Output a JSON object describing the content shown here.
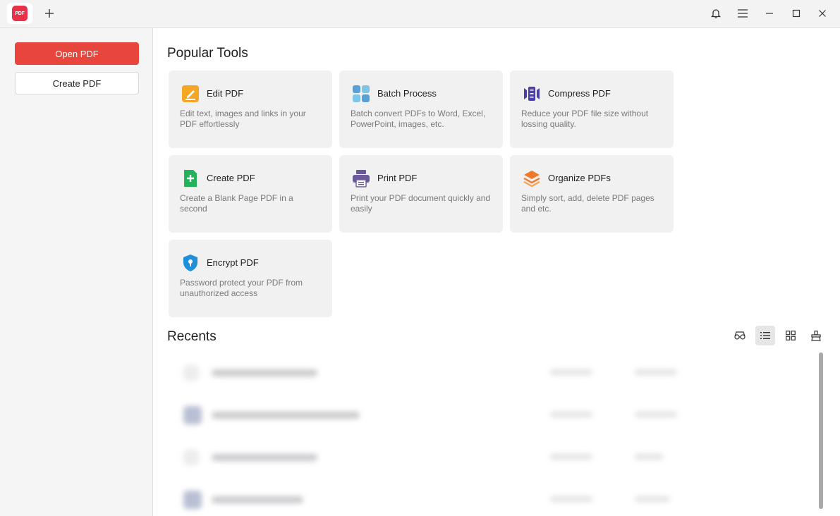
{
  "titlebar": {
    "app_logo_text": "PDF",
    "icons": [
      "plus-icon",
      "bell-icon",
      "menu-icon",
      "minimize-icon",
      "maximize-icon",
      "close-icon"
    ]
  },
  "sidebar": {
    "open_label": "Open PDF",
    "create_label": "Create PDF"
  },
  "main": {
    "popular_title": "Popular Tools",
    "recents_title": "Recents",
    "tools": [
      {
        "title": "Edit PDF",
        "desc": "Edit text, images and links in your PDF effortlessly",
        "icon": "edit-pencil-icon",
        "color": "#f5a623"
      },
      {
        "title": "Batch Process",
        "desc": "Batch convert PDFs to Word, Excel, PowerPoint, images, etc.",
        "icon": "batch-grid-icon",
        "color": "#5aa0d8"
      },
      {
        "title": "Compress PDF",
        "desc": "Reduce your PDF file size without lossing quality.",
        "icon": "compress-icon",
        "color": "#4b3fa8"
      },
      {
        "title": "Create PDF",
        "desc": "Create a Blank Page PDF in a second",
        "icon": "create-plus-icon",
        "color": "#22b35a"
      },
      {
        "title": "Print PDF",
        "desc": "Print your PDF document quickly and easily",
        "icon": "printer-icon",
        "color": "#6b5b9a"
      },
      {
        "title": "Organize PDFs",
        "desc": "Simply sort, add, delete PDF pages and etc.",
        "icon": "layers-icon",
        "color": "#f07a2a"
      },
      {
        "title": "Encrypt PDF",
        "desc": "Password protect your PDF from unauthorized access",
        "icon": "shield-lock-icon",
        "color": "#1e8fd8"
      }
    ],
    "view_buttons": [
      "glasses-icon",
      "list-view-icon",
      "grid-view-icon",
      "clean-icon"
    ]
  },
  "colors": {
    "accent": "#e8453c",
    "card_bg": "#f1f1f1",
    "sidebar_bg": "#f5f5f5"
  }
}
